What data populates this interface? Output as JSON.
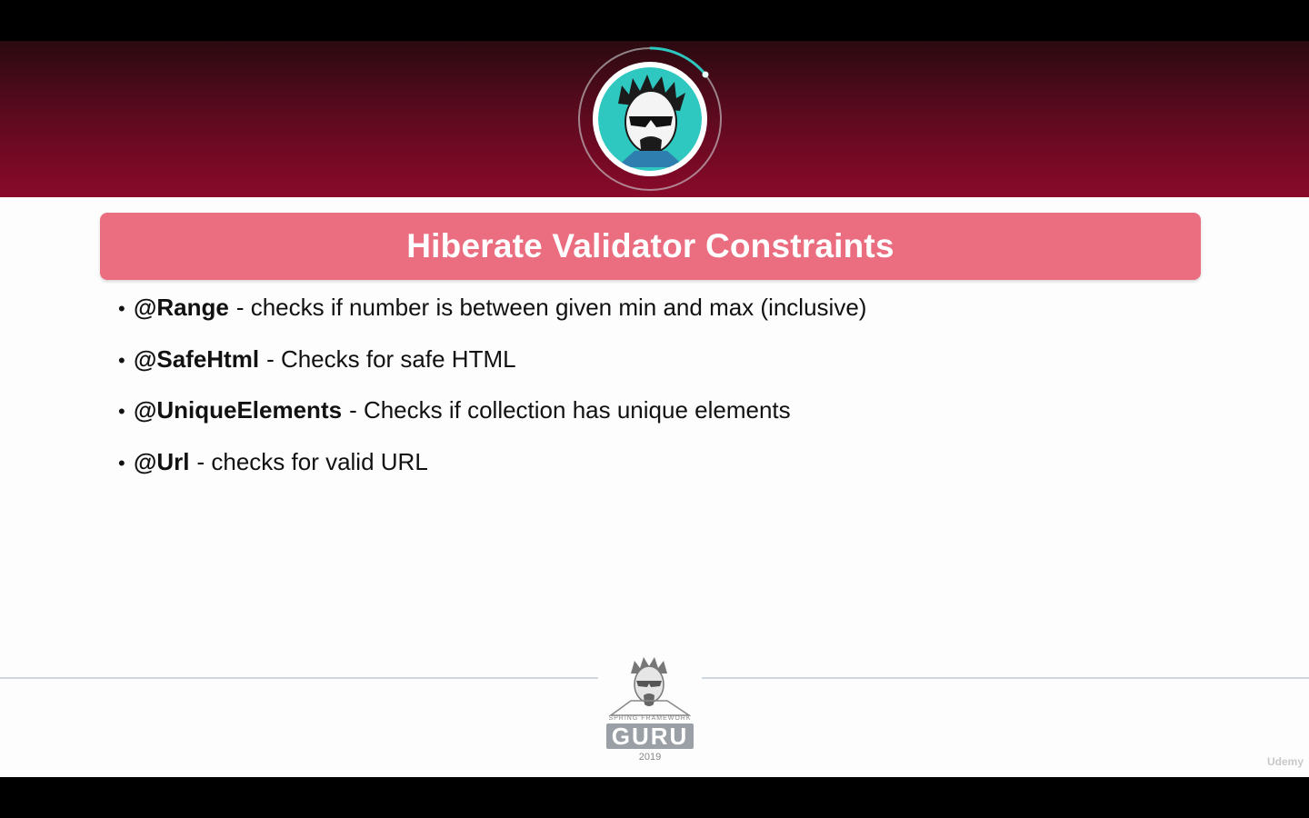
{
  "slide": {
    "title": "Hiberate Validator Constraints",
    "bullets": [
      {
        "annotation": "@Range",
        "text": "- checks if number is between given min and max (inclusive)"
      },
      {
        "annotation": "@SafeHtml",
        "text": "- Checks for safe HTML"
      },
      {
        "annotation": "@UniqueElements",
        "text": "- Checks if collection has unique elements"
      },
      {
        "annotation": "@Url",
        "text": "- checks for valid URL"
      }
    ]
  },
  "footer": {
    "logo_small_text": "SPRING FRAMEWORK",
    "logo_word": "GURU",
    "logo_year": "2019"
  },
  "watermark": "Udemy",
  "colors": {
    "header_dark": "#2a0a10",
    "header_light": "#8a0a2a",
    "title_bar": "#ea6e80",
    "avatar_bg": "#2ec8c0",
    "ring": "#2ec8c0"
  },
  "icons": [
    "presenter-avatar-icon",
    "guru-logo-icon",
    "udemy-logo-icon"
  ]
}
